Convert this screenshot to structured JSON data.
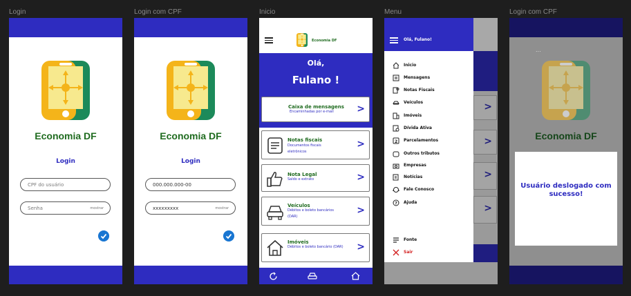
{
  "frames": {
    "login": {
      "label": "Login",
      "brand": "Economia DF",
      "title": "Login",
      "cpf_placeholder": "CPF do usuário",
      "password_placeholder": "Senha",
      "show_label": "mostrar"
    },
    "login_cpf": {
      "label": "Login com CPF",
      "brand": "Economia DF",
      "title": "Login",
      "cpf_value": "000.000.000-00",
      "password_value": "xxxxxxxxx",
      "show_label": "mostrar"
    },
    "inicio": {
      "label": "Inicio",
      "brand": "Economia DF",
      "greeting_line1": "Olá,",
      "greeting_line2": "Fulano !",
      "inbox": {
        "title": "Caixa de mensagens",
        "subtitle": "Encaminhadas por e-mail"
      },
      "cards": [
        {
          "title": "Notas fiscais",
          "subtitle": "Documentos fiscais eletrônicos",
          "icon": "document-icon"
        },
        {
          "title": "Nota Legal",
          "subtitle": "Saldo e extrato",
          "icon": "thumbs-up-icon"
        },
        {
          "title": "Veículos",
          "subtitle": "Débitos e boleto bancários (DAR)",
          "icon": "car-icon"
        },
        {
          "title": "Imóveis",
          "subtitle": "Débitos e boleto bancário (DAR)",
          "icon": "house-icon"
        }
      ],
      "arrow": ">"
    },
    "menu": {
      "label": "Menu",
      "user": "Olá, Fulano!",
      "items": [
        {
          "label": "Inicio",
          "icon": "home-icon"
        },
        {
          "label": "Mensagens",
          "icon": "message-icon"
        },
        {
          "label": "Notas Fiscais",
          "icon": "invoice-icon"
        },
        {
          "label": "Veículos",
          "icon": "car-icon"
        },
        {
          "label": "Imóveis",
          "icon": "building-icon"
        },
        {
          "label": "Dívida Ativa",
          "icon": "debt-icon"
        },
        {
          "label": "Parcelamentos",
          "icon": "installment-icon"
        },
        {
          "label": "Outros tributos",
          "icon": "tax-icon"
        },
        {
          "label": "Empresas",
          "icon": "company-icon"
        },
        {
          "label": "Notícias",
          "icon": "news-icon"
        },
        {
          "label": "Fale Conosco",
          "icon": "support-icon"
        },
        {
          "label": "Ajuda",
          "icon": "help-icon"
        }
      ],
      "font_label": "Fonte",
      "exit_label": "Sair"
    },
    "logout": {
      "label": "Login com CPF",
      "brand": "Economia DF",
      "dots": "...",
      "message": "Usuário deslogado com sucesso!"
    }
  },
  "colors": {
    "primary": "#2e2cc0",
    "green": "#1f6b1f",
    "check": "#1976d2",
    "danger": "#d32020"
  }
}
